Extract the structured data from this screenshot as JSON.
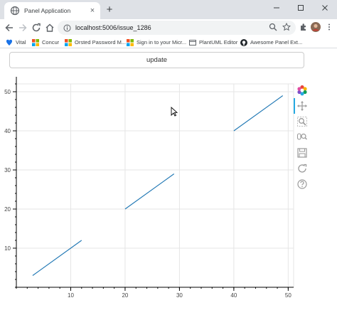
{
  "browser": {
    "tab": {
      "title": "Panel Application",
      "close_glyph": "×"
    },
    "new_tab_glyph": "+",
    "url": "localhost:5006/issue_1286",
    "bookmarks": [
      {
        "label": "Vital",
        "icon": "vital-icon"
      },
      {
        "label": "Concur",
        "icon": "microsoft-icon"
      },
      {
        "label": "Orsted Password M...",
        "icon": "microsoft-icon"
      },
      {
        "label": "Sign in to your Micr...",
        "icon": "microsoft-icon"
      },
      {
        "label": "PlantUML Editor",
        "icon": "page-icon"
      },
      {
        "label": "Awesome Panel Ext...",
        "icon": "github-icon"
      }
    ]
  },
  "page": {
    "update_label": "update"
  },
  "colors": {
    "line": "#1f77b4",
    "grid": "#e5e5e5",
    "active_tool": "#26aae1"
  },
  "chart_data": {
    "type": "line",
    "series": [
      {
        "x": [
          3,
          12
        ],
        "y": [
          3,
          12
        ]
      },
      {
        "x": [
          20,
          29
        ],
        "y": [
          20,
          29
        ]
      },
      {
        "x": [
          40,
          49
        ],
        "y": [
          40,
          49
        ]
      }
    ],
    "xlim": [
      0,
      51
    ],
    "ylim": [
      0,
      52
    ],
    "x_ticks": [
      10,
      20,
      30,
      40,
      50
    ],
    "y_ticks": [
      10,
      20,
      30,
      40,
      50
    ],
    "x_tick_labels": [
      "10",
      "20",
      "30",
      "40",
      "50"
    ],
    "y_tick_labels": [
      "10",
      "20",
      "30",
      "40",
      "50"
    ],
    "grid": true,
    "toolbar_tools": [
      "bokeh-logo-icon",
      "pan-tool-icon",
      "box-zoom-tool-icon",
      "wheel-zoom-tool-icon",
      "save-tool-icon",
      "reset-tool-icon",
      "help-tool-icon"
    ]
  }
}
